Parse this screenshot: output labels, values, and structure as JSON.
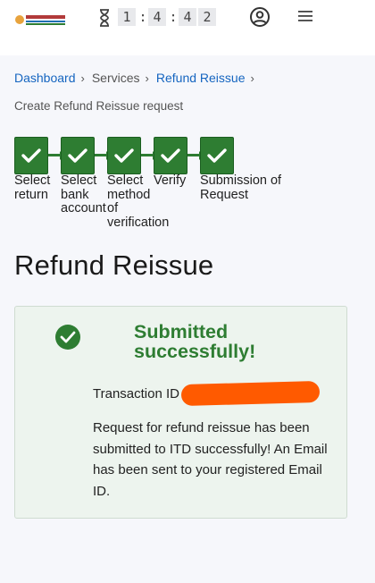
{
  "header": {
    "logo_icon": "efiling-logo-icon",
    "timer": {
      "digits": [
        "1",
        "4",
        "2"
      ],
      "hour": "1",
      "min_tens": "4",
      "sec_tens": "4",
      "sec_ones": "2",
      "separator": ":"
    },
    "profile_icon": "account-circle-icon",
    "menu_icon": "hamburger-menu-icon"
  },
  "breadcrumb": {
    "items": [
      "Dashboard",
      "Services",
      "Refund Reissue"
    ],
    "separator": "›"
  },
  "subtitle": "Create Refund Reissue request",
  "stepper": {
    "steps": [
      {
        "label": "Select return",
        "status": "completed"
      },
      {
        "label": "Select bank account",
        "status": "completed"
      },
      {
        "label": "Select method of verification",
        "status": "completed"
      },
      {
        "label": "Verify",
        "status": "completed"
      },
      {
        "label": "Submission of Request",
        "status": "completed"
      }
    ]
  },
  "page_title": "Refund Reissue",
  "success_card": {
    "heading": "Submitted successfully!",
    "transaction_label": "Transaction ID",
    "message": "Request for refund reissue has been submitted to ITD successfully! An Email has been sent to your registered Email ID.",
    "colors": {
      "accent": "#2e7d32",
      "background": "#edf4ee",
      "redaction": "#ff5a00"
    }
  }
}
